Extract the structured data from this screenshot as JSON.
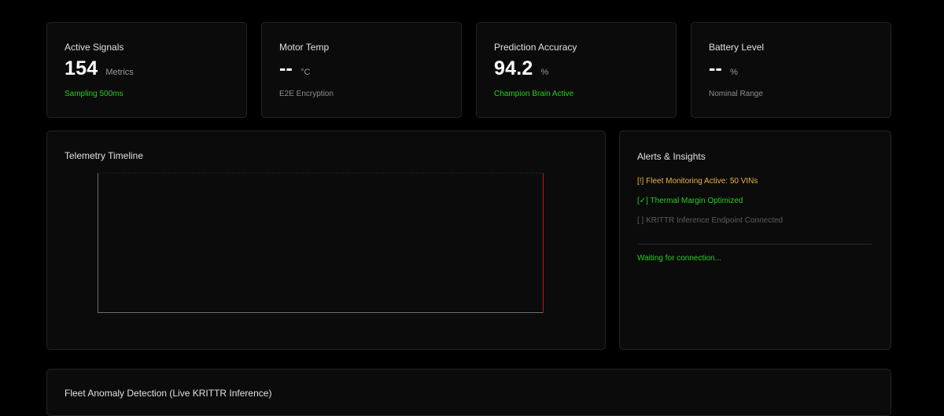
{
  "stats": [
    {
      "label": "Active Signals",
      "value": "154",
      "unit": "Metrics",
      "sub": "Sampling 500ms",
      "sub_color": "#22d11f"
    },
    {
      "label": "Motor Temp",
      "value": "--",
      "unit": "°C",
      "sub": "E2E Encryption",
      "sub_color": "#8f8f8f"
    },
    {
      "label": "Prediction Accuracy",
      "value": "94.2",
      "unit": "%",
      "sub": "Champion Brain Active",
      "sub_color": "#22d11f"
    },
    {
      "label": "Battery Level",
      "value": "--",
      "unit": "%",
      "sub": "Nominal Range",
      "sub_color": "#8f8f8f"
    }
  ],
  "timeline": {
    "title": "Telemetry Timeline",
    "axis_color": "#6e6e6e",
    "marker_color": "#b01b1b"
  },
  "alerts_panel": {
    "title": "Alerts & Insights",
    "items": [
      {
        "text": "[!] Fleet Monitoring Active: 50 VINs",
        "color": "#e8b14a"
      },
      {
        "text": "[✓] Thermal Margin Optimized",
        "color": "#22d11f"
      },
      {
        "text": "[ ] KRITTR Inference Endpoint Connected",
        "color": "#5d5d5d"
      }
    ],
    "status": "Waiting for connection..."
  },
  "anomaly_panel": {
    "title": "Fleet Anomaly Detection (Live KRITTR Inference)"
  }
}
